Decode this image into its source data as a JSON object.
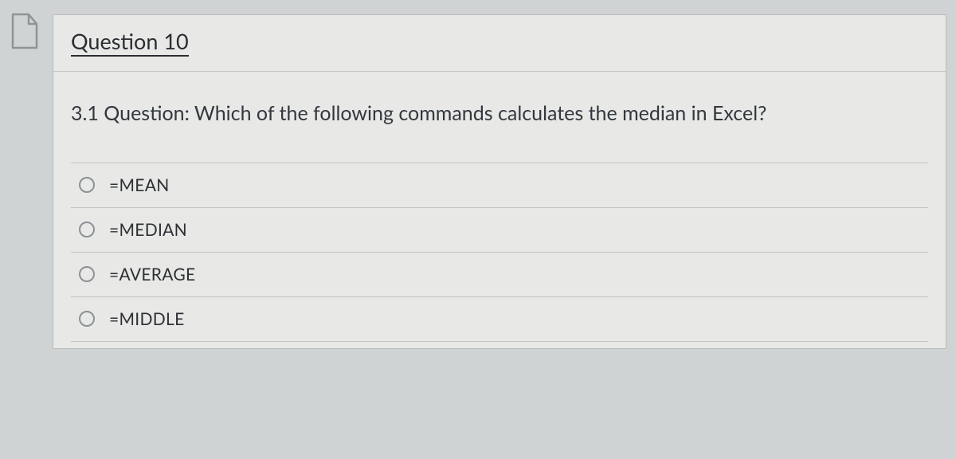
{
  "header": {
    "title": "Question 10"
  },
  "question": {
    "text": "3.1 Question: Which of the following commands calculates the median in Excel?"
  },
  "options": [
    {
      "label": "=MEAN"
    },
    {
      "label": "=MEDIAN"
    },
    {
      "label": "=AVERAGE"
    },
    {
      "label": "=MIDDLE"
    }
  ]
}
